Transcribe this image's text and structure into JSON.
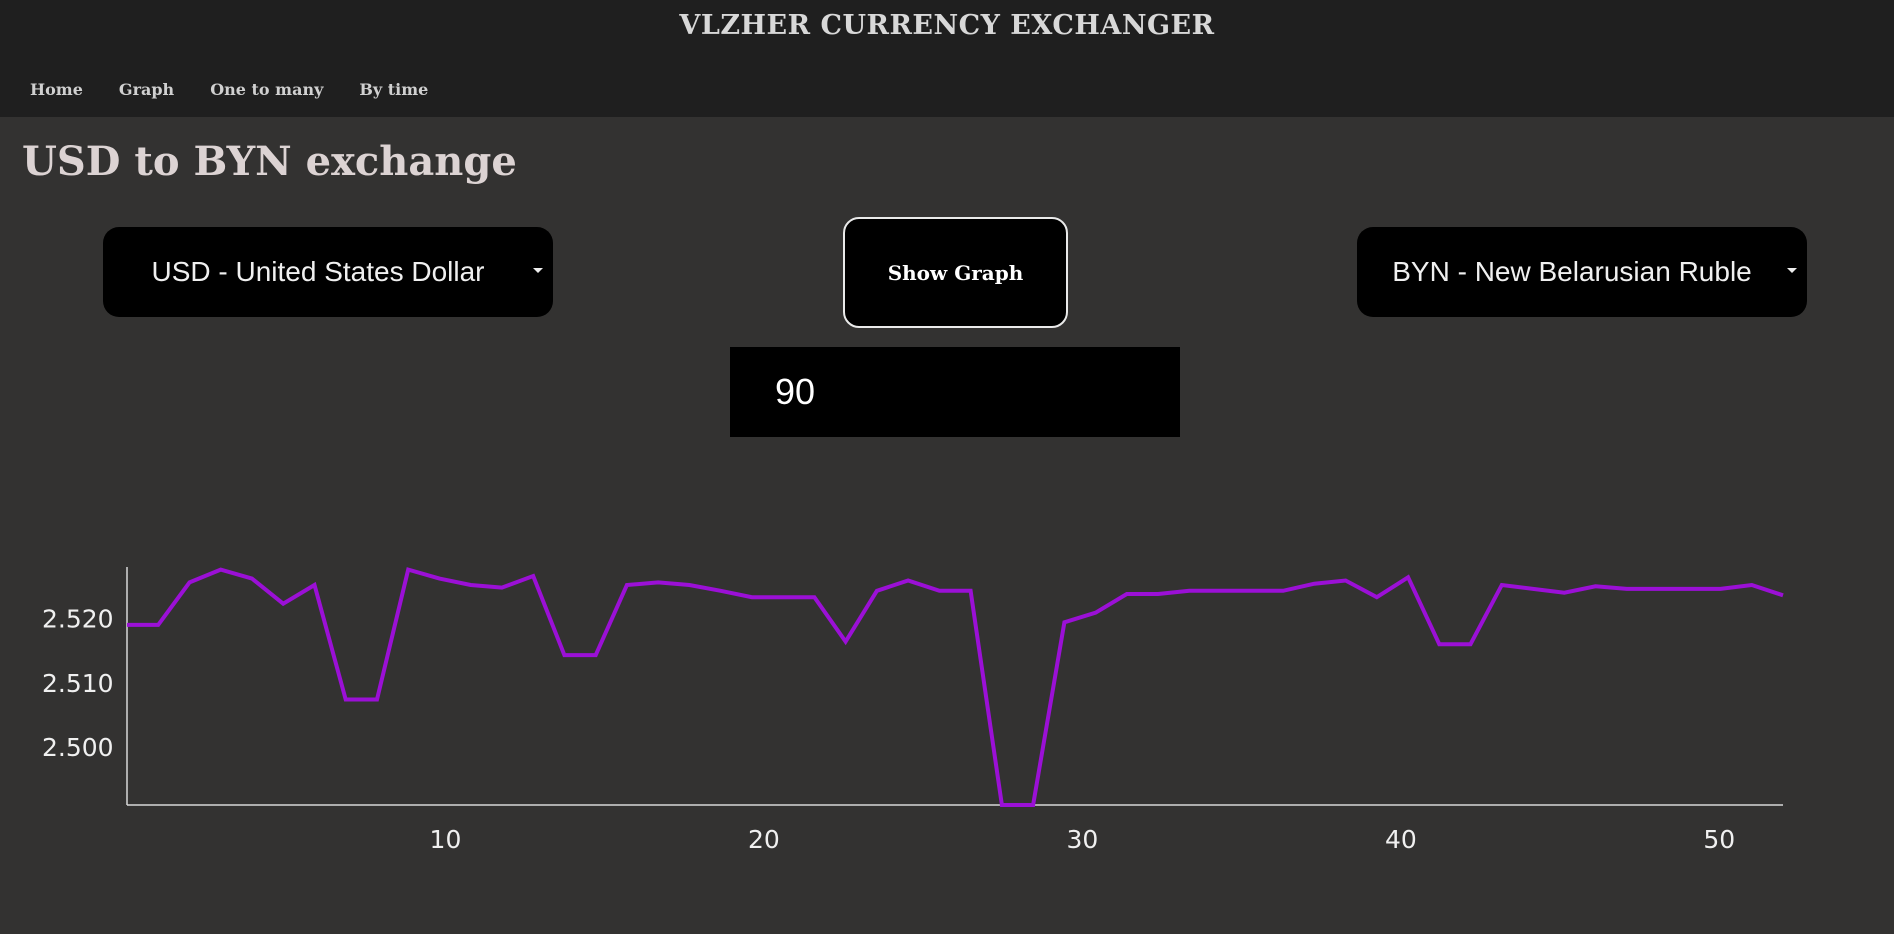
{
  "header": {
    "title": "VLZHER CURRENCY EXCHANGER",
    "nav": [
      "Home",
      "Graph",
      "One to many",
      "By time"
    ]
  },
  "page": {
    "title": "USD to BYN exchange"
  },
  "controls": {
    "from_currency": "USD - United States Dollar",
    "to_currency": "BYN - New Belarusian Ruble",
    "show_graph_label": "Show Graph",
    "amount_value": "90"
  },
  "colors": {
    "line": "#9b10d6",
    "background": "#333231",
    "header": "#1f1f1f"
  },
  "chart_data": {
    "type": "line",
    "title": "",
    "xlabel": "",
    "ylabel": "",
    "xlim": [
      0,
      52
    ],
    "ylim": [
      2.491,
      2.528
    ],
    "x_ticks": [
      10,
      20,
      30,
      40,
      50
    ],
    "y_ticks": [
      2.5,
      2.51,
      2.52
    ],
    "y_tick_labels": [
      "2.500",
      "2.510",
      "2.520"
    ],
    "grid": false,
    "series": [
      {
        "values": [
          2.519,
          2.519,
          2.5256,
          2.5276,
          2.5262,
          2.5223,
          2.5252,
          2.5074,
          2.5074,
          2.5276,
          2.5262,
          2.5252,
          2.5248,
          2.5266,
          2.5143,
          2.5143,
          2.5252,
          2.5256,
          2.5252,
          2.5243,
          2.5233,
          2.5233,
          2.5233,
          2.5164,
          2.5243,
          2.5259,
          2.5243,
          2.5243,
          2.491,
          2.491,
          2.5194,
          2.5209,
          2.5238,
          2.5238,
          2.5243,
          2.5243,
          2.5243,
          2.5243,
          2.5254,
          2.5259,
          2.5233,
          2.5264,
          2.516,
          2.516,
          2.5252,
          2.5246,
          2.524,
          2.525,
          2.5246,
          2.5246,
          2.5246,
          2.5246,
          2.5252,
          2.5236
        ]
      }
    ]
  }
}
